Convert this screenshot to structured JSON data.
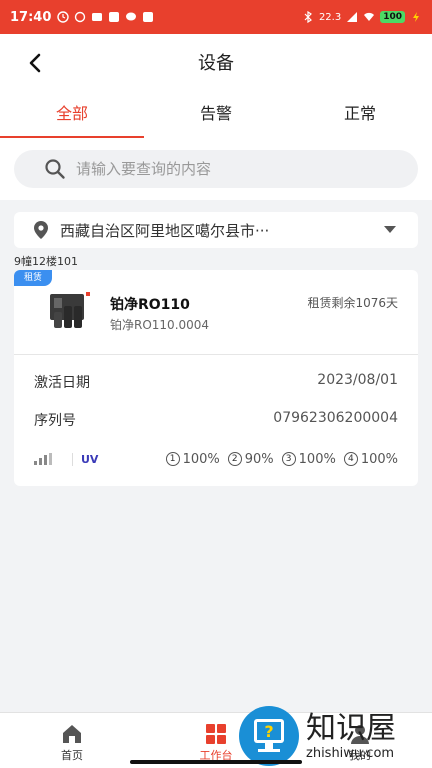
{
  "status_bar": {
    "time": "17:40",
    "net_speed": "22.3",
    "battery": "100"
  },
  "header": {
    "title": "设备"
  },
  "tabs": [
    {
      "label": "全部",
      "active": true
    },
    {
      "label": "告警",
      "active": false
    },
    {
      "label": "正常",
      "active": false
    }
  ],
  "search": {
    "placeholder": "请输入要查询的内容",
    "value": ""
  },
  "location": {
    "text": "西藏自治区阿里地区噶尔县市···"
  },
  "group": {
    "label": "9幢12楼101"
  },
  "device": {
    "badge": "租赁",
    "name": "铂净RO110",
    "model": "铂净RO110.0004",
    "rent_remaining": "租赁剩余1076天",
    "activation_label": "激活日期",
    "activation_value": "2023/08/01",
    "serial_label": "序列号",
    "serial_value": "07962306200004",
    "uv_label": "UV",
    "filters": [
      {
        "num": "1",
        "value": "100%"
      },
      {
        "num": "2",
        "value": "90%"
      },
      {
        "num": "3",
        "value": "100%"
      },
      {
        "num": "4",
        "value": "100%"
      }
    ]
  },
  "bottom_nav": [
    {
      "label": "首页",
      "active": false
    },
    {
      "label": "工作台",
      "active": true
    },
    {
      "label": "我的",
      "active": false
    }
  ],
  "watermark": {
    "cn": "知识屋",
    "en": "zhishiwu.com"
  },
  "colors": {
    "accent": "#e8402d",
    "badge": "#3b8ff0"
  }
}
